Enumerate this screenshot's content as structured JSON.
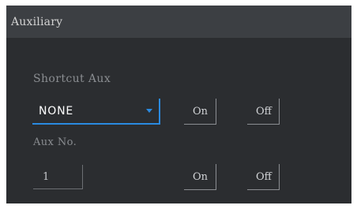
{
  "panel": {
    "title": "Auxiliary"
  },
  "shortcut_aux": {
    "label": "Shortcut Aux",
    "selected": "NONE",
    "on_label": "On",
    "off_label": "Off"
  },
  "aux_no": {
    "label": "Aux No.",
    "value": "1",
    "on_label": "On",
    "off_label": "Off"
  },
  "colors": {
    "accent": "#2a8ae0",
    "panel_bg": "#2b2d30",
    "header_bg": "#3c3f43"
  }
}
